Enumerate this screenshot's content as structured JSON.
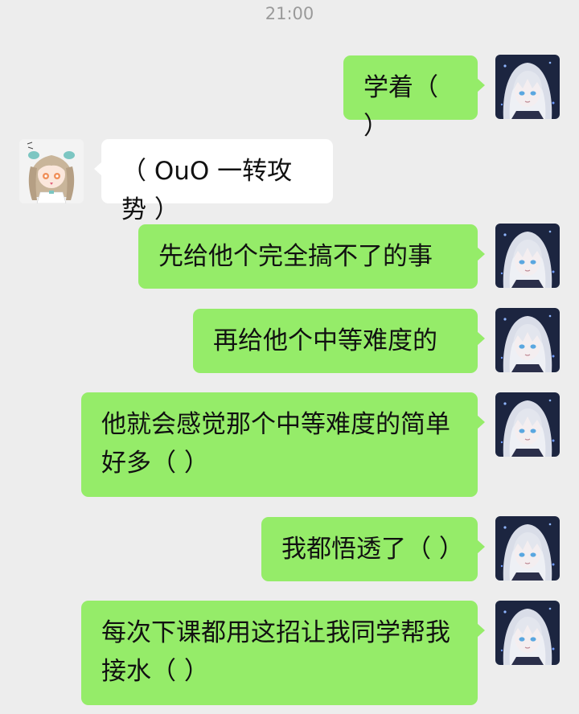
{
  "chat": {
    "timestamp": "21:00",
    "messages": [
      {
        "sender": "me",
        "text": "学着（ ）"
      },
      {
        "sender": "other",
        "text": "（ OuO 一转攻势 ）"
      },
      {
        "sender": "me",
        "text": "先给他个完全搞不了的事"
      },
      {
        "sender": "me",
        "text": "再给他个中等难度的"
      },
      {
        "sender": "me",
        "text": "他就会感觉那个中等难度的简单好多（ ）"
      },
      {
        "sender": "me",
        "text": "我都悟透了（ ）"
      },
      {
        "sender": "me",
        "text": "每次下课都用这招让我同学帮我接水（ ）"
      }
    ]
  },
  "colors": {
    "background": "#ededed",
    "my_bubble": "#95ec69",
    "other_bubble": "#ffffff",
    "timestamp_text": "#9a9a9a"
  },
  "icons": {
    "my_avatar": "silver-haired-anime-avatar-icon",
    "other_avatar": "twin-tail-chibi-avatar-icon"
  }
}
